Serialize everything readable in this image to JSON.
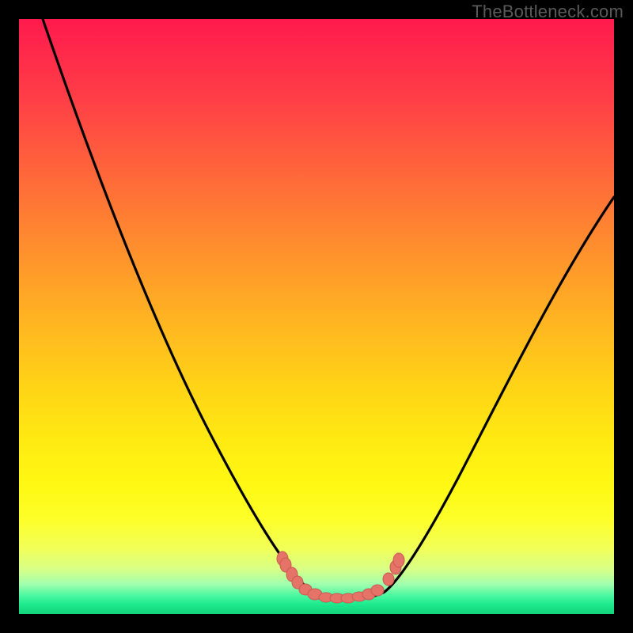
{
  "watermark": {
    "text": "TheBottleneck.com"
  },
  "colors": {
    "black": "#000000",
    "curve": "#000000",
    "marker_fill": "#e57368",
    "marker_stroke": "#c85a52"
  },
  "chart_data": {
    "type": "line",
    "title": "",
    "xlabel": "",
    "ylabel": "",
    "xlim": [
      0,
      100
    ],
    "ylim": [
      0,
      100
    ],
    "grid": false,
    "legend": false,
    "series": [
      {
        "name": "left-curve",
        "x": [
          4,
          8,
          12,
          16,
          20,
          24,
          28,
          32,
          36,
          40,
          44,
          47,
          49
        ],
        "y": [
          100,
          90,
          80,
          70,
          60,
          50,
          40,
          30,
          21,
          13,
          7,
          4,
          3
        ]
      },
      {
        "name": "right-curve",
        "x": [
          60,
          63,
          67,
          72,
          78,
          85,
          92,
          100
        ],
        "y": [
          3,
          5,
          10,
          18,
          30,
          45,
          58,
          70
        ]
      },
      {
        "name": "floor-band",
        "x": [
          49,
          52,
          55,
          58,
          60
        ],
        "y": [
          3,
          2.5,
          2.5,
          2.7,
          3
        ]
      }
    ],
    "markers": {
      "name": "highlight-dots",
      "color": "#e57368",
      "points": [
        {
          "x": 44.0,
          "y": 8.8
        },
        {
          "x": 44.2,
          "y": 8.0
        },
        {
          "x": 45.0,
          "y": 6.5
        },
        {
          "x": 46.0,
          "y": 5.2
        },
        {
          "x": 47.5,
          "y": 4.0
        },
        {
          "x": 49.0,
          "y": 3.3
        },
        {
          "x": 51.0,
          "y": 3.0
        },
        {
          "x": 53.0,
          "y": 2.9
        },
        {
          "x": 55.0,
          "y": 2.9
        },
        {
          "x": 57.0,
          "y": 3.1
        },
        {
          "x": 58.5,
          "y": 3.6
        },
        {
          "x": 60.0,
          "y": 4.2
        },
        {
          "x": 62.0,
          "y": 6.2
        },
        {
          "x": 63.0,
          "y": 8.0
        },
        {
          "x": 63.4,
          "y": 9.0
        }
      ]
    }
  }
}
